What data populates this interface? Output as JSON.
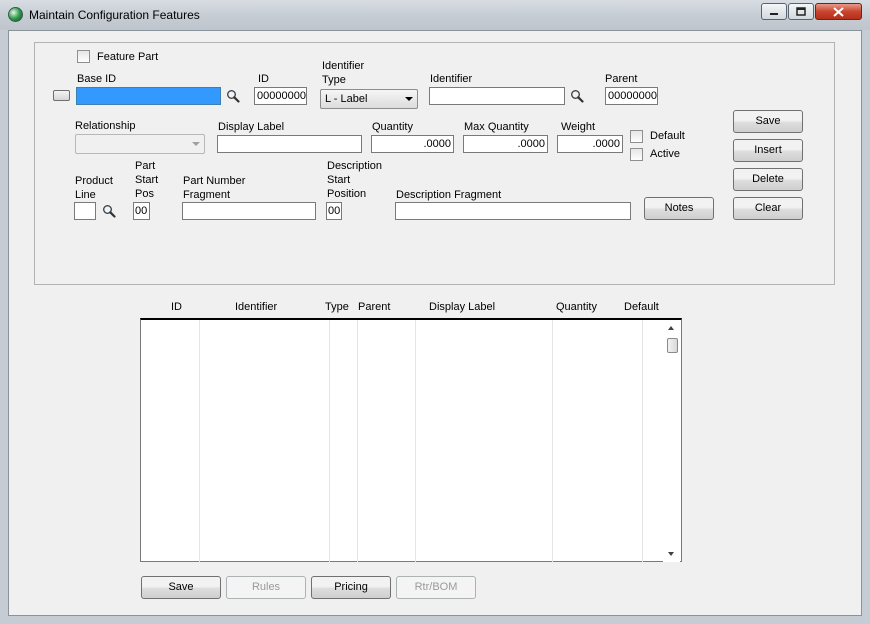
{
  "window": {
    "title": "Maintain Configuration Features"
  },
  "form": {
    "feature_part_label": "Feature Part",
    "base_id_label": "Base ID",
    "base_id_value": "",
    "id_label": "ID",
    "id_value": "00000000",
    "identifier_type_label": "Identifier Type",
    "identifier_type_value": "L - Label",
    "identifier_label": "Identifier",
    "identifier_value": "",
    "parent_label": "Parent",
    "parent_value": "00000000",
    "relationship_label": "Relationship",
    "relationship_value": "",
    "display_label_label": "Display Label",
    "display_label_value": "",
    "quantity_label": "Quantity",
    "quantity_value": ".0000",
    "max_quantity_label": "Max Quantity",
    "max_quantity_value": ".0000",
    "weight_label": "Weight",
    "weight_value": ".0000",
    "default_label": "Default",
    "active_label": "Active",
    "product_line_label": "Product Line",
    "product_line_value": "",
    "part_start_pos_label": "Part Start Pos",
    "part_start_pos_value": "00",
    "part_number_fragment_label": "Part Number Fragment",
    "part_number_fragment_value": "",
    "desc_start_position_label": "Description Start Position",
    "desc_start_position_value": "00",
    "description_fragment_label": "Description Fragment",
    "description_fragment_value": "",
    "notes_button": "Notes"
  },
  "side_buttons": {
    "save": "Save",
    "insert": "Insert",
    "delete": "Delete",
    "clear": "Clear"
  },
  "list": {
    "columns": [
      "ID",
      "Identifier",
      "Type",
      "Parent",
      "Display Label",
      "Quantity",
      "Default"
    ]
  },
  "bottom_buttons": {
    "save": "Save",
    "rules": "Rules",
    "pricing": "Pricing",
    "rtr_bom": "Rtr/BOM"
  },
  "colors": {
    "selection_blue": "#3399ff",
    "close_red": "#c8452f"
  },
  "icons": [
    "app-icon",
    "search-icon",
    "minimize-icon",
    "maximize-icon",
    "close-icon"
  ]
}
